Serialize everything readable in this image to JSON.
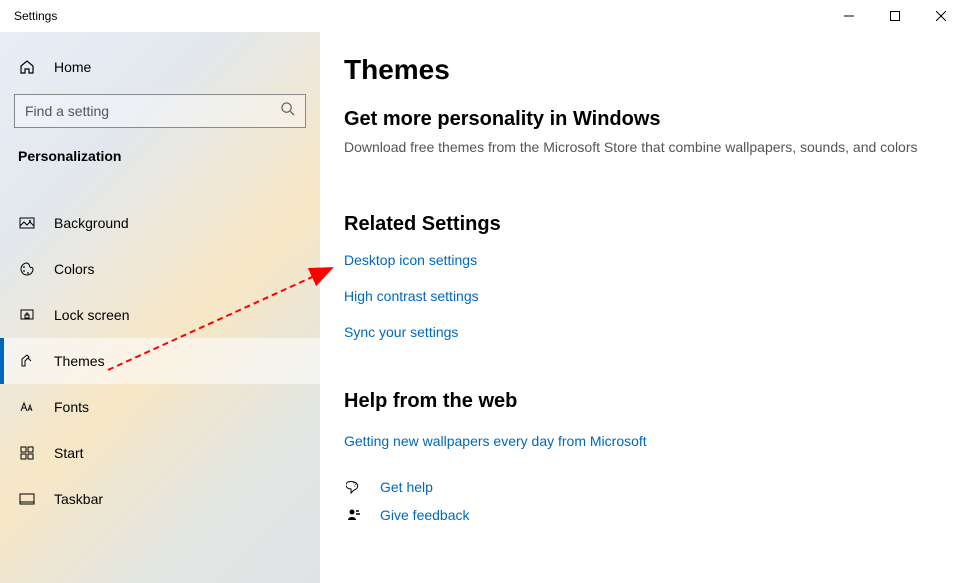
{
  "window": {
    "title": "Settings"
  },
  "sidebar": {
    "home": "Home",
    "search_placeholder": "Find a setting",
    "category": "Personalization",
    "items": [
      {
        "label": "Background"
      },
      {
        "label": "Colors"
      },
      {
        "label": "Lock screen"
      },
      {
        "label": "Themes"
      },
      {
        "label": "Fonts"
      },
      {
        "label": "Start"
      },
      {
        "label": "Taskbar"
      }
    ]
  },
  "main": {
    "title": "Themes",
    "personality_heading": "Get more personality in Windows",
    "personality_desc": "Download free themes from the Microsoft Store that combine wallpapers, sounds, and colors",
    "related_heading": "Related Settings",
    "related_links": {
      "desktop_icon": "Desktop icon settings",
      "high_contrast": "High contrast settings",
      "sync": "Sync your settings"
    },
    "help_heading": "Help from the web",
    "help_link": "Getting new wallpapers every day from Microsoft",
    "get_help": "Get help",
    "give_feedback": "Give feedback"
  }
}
